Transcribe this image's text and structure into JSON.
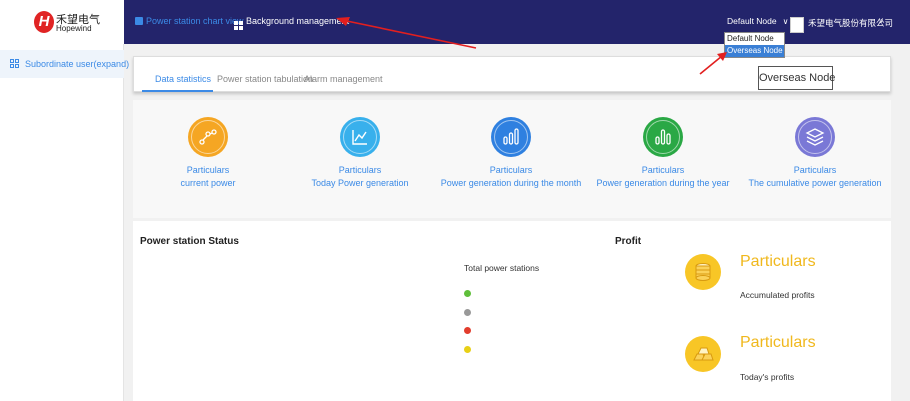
{
  "brand": {
    "name_cn": "禾望电气",
    "name_en": "Hopewind"
  },
  "nav": {
    "chart_view": "Power station chart view",
    "background": "Background management"
  },
  "node": {
    "selected": "Default Node",
    "options": [
      "Default Node",
      "Overseas Node"
    ],
    "highlighted": "Overseas Node"
  },
  "user": {
    "company": "禾望电气股份有限公司"
  },
  "sidebar": {
    "items": [
      {
        "label": "Subordinate user(expand)"
      }
    ]
  },
  "tabs": [
    {
      "label": "Data statistics",
      "active": true
    },
    {
      "label": "Power station tabulation",
      "active": false
    },
    {
      "label": "Alarm management",
      "active": false
    }
  ],
  "current_node_box": "Overseas Node",
  "stats": [
    {
      "value": "Particulars",
      "label": "current power",
      "icon": "line-chart-icon",
      "color": "#f5a623"
    },
    {
      "value": "Particulars",
      "label": "Today Power generation",
      "icon": "area-chart-icon",
      "color": "#38b0ec"
    },
    {
      "value": "Particulars",
      "label": "Power generation during the month",
      "icon": "bar-chart-icon",
      "color": "#2f80e0"
    },
    {
      "value": "Particulars",
      "label": "Power generation during the year",
      "icon": "bar-chart-icon",
      "color": "#2aa845"
    },
    {
      "value": "Particulars",
      "label": "The cumulative power generation",
      "icon": "layers-icon",
      "color": "#7a78d6"
    }
  ],
  "status": {
    "title": "Power station Status",
    "total_label": "Total power stations",
    "legend_colors": [
      "#5fbf3a",
      "#999999",
      "#e23d2d",
      "#e8d016"
    ]
  },
  "profit": {
    "title": "Profit",
    "items": [
      {
        "value": "Particulars",
        "label": "Accumulated profits",
        "icon": "coin-stack-icon"
      },
      {
        "value": "Particulars",
        "label": "Today's profits",
        "icon": "gold-bars-icon"
      }
    ]
  }
}
